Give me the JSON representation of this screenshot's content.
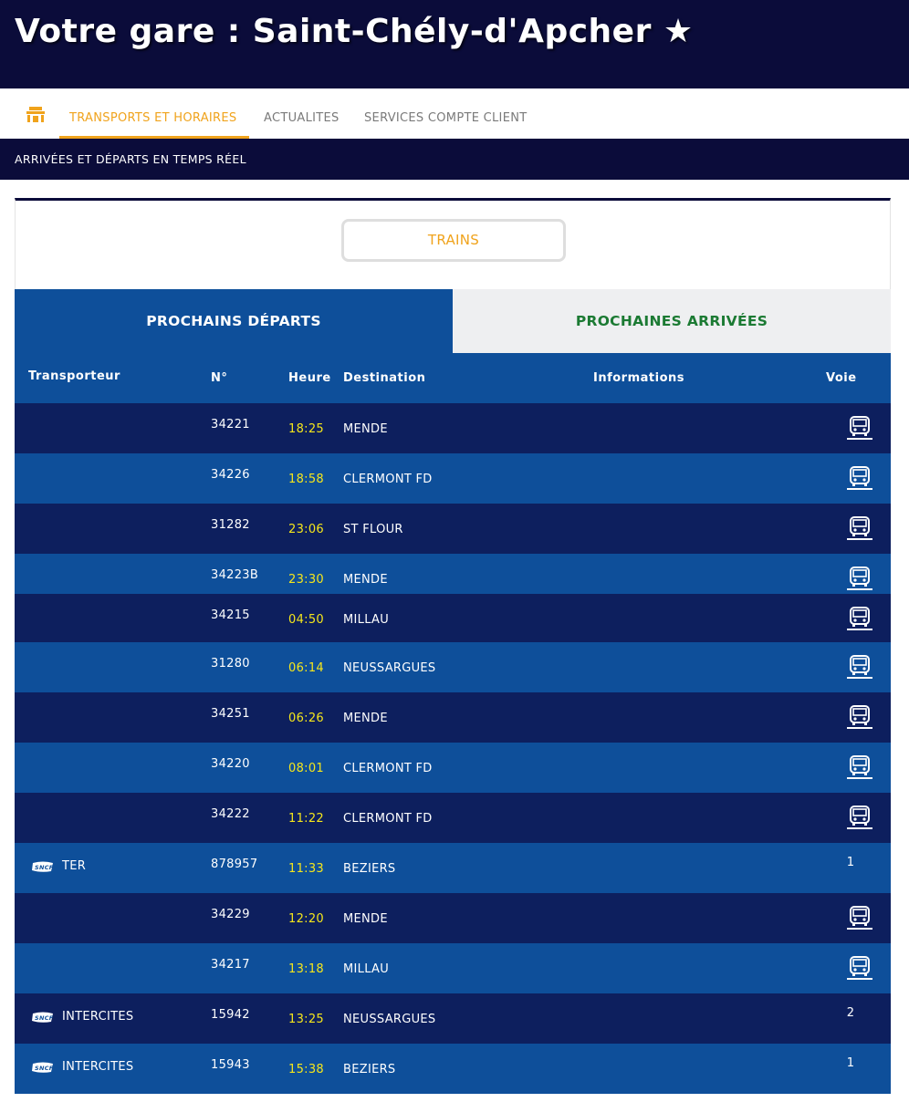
{
  "header": {
    "title": "Votre gare : Saint-Chély-d'Apcher ★"
  },
  "nav": {
    "home_icon": "home-station-icon",
    "tabs": [
      {
        "label": "TRANSPORTS ET HORAIRES",
        "active": true
      },
      {
        "label": "ACTUALITES",
        "active": false
      },
      {
        "label": "SERVICES COMPTE CLIENT",
        "active": false
      }
    ]
  },
  "subbar": {
    "label": "ARRIVÉES ET DÉPARTS EN TEMPS RÉEL"
  },
  "filter": {
    "trains_label": "TRAINS"
  },
  "board_tabs": {
    "departures": "PROCHAINS DÉPARTS",
    "arrivals": "PROCHAINES ARRIVÉES"
  },
  "columns": {
    "carrier": "Transporteur",
    "number": "N°",
    "time": "Heure",
    "destination": "Destination",
    "info": "Informations",
    "track": "Voie"
  },
  "colors": {
    "navy": "#0b0c3a",
    "blue": "#0e4f9a",
    "dark_row": "#0d1f5e",
    "accent": "#f0a31c",
    "time": "#f5e61b",
    "arrivals_text": "#1b7a33"
  },
  "rows": [
    {
      "carrier": "",
      "number": "34221",
      "time": "18:25",
      "destination": "MENDE",
      "track": "",
      "bus": true
    },
    {
      "carrier": "",
      "number": "34226",
      "time": "18:58",
      "destination": "CLERMONT FD",
      "track": "",
      "bus": true
    },
    {
      "carrier": "",
      "number": "31282",
      "time": "23:06",
      "destination": "ST FLOUR",
      "track": "",
      "bus": true
    },
    {
      "carrier": "",
      "number": "34223B",
      "time": "23:30",
      "destination": "MENDE",
      "track": "",
      "bus": true
    },
    {
      "carrier": "",
      "number": "34215",
      "time": "04:50",
      "destination": "MILLAU",
      "track": "",
      "bus": true
    },
    {
      "carrier": "",
      "number": "31280",
      "time": "06:14",
      "destination": "NEUSSARGUES",
      "track": "",
      "bus": true
    },
    {
      "carrier": "",
      "number": "34251",
      "time": "06:26",
      "destination": "MENDE",
      "track": "",
      "bus": true
    },
    {
      "carrier": "",
      "number": "34220",
      "time": "08:01",
      "destination": "CLERMONT FD",
      "track": "",
      "bus": true
    },
    {
      "carrier": "",
      "number": "34222",
      "time": "11:22",
      "destination": "CLERMONT FD",
      "track": "",
      "bus": true
    },
    {
      "carrier": "TER",
      "number": "878957",
      "time": "11:33",
      "destination": "BEZIERS",
      "track": "1",
      "bus": false
    },
    {
      "carrier": "",
      "number": "34229",
      "time": "12:20",
      "destination": "MENDE",
      "track": "",
      "bus": true
    },
    {
      "carrier": "",
      "number": "34217",
      "time": "13:18",
      "destination": "MILLAU",
      "track": "",
      "bus": true
    },
    {
      "carrier": "INTERCITES",
      "number": "15942",
      "time": "13:25",
      "destination": "NEUSSARGUES",
      "track": "2",
      "bus": false
    },
    {
      "carrier": "INTERCITES",
      "number": "15943",
      "time": "15:38",
      "destination": "BEZIERS",
      "track": "1",
      "bus": false
    }
  ]
}
